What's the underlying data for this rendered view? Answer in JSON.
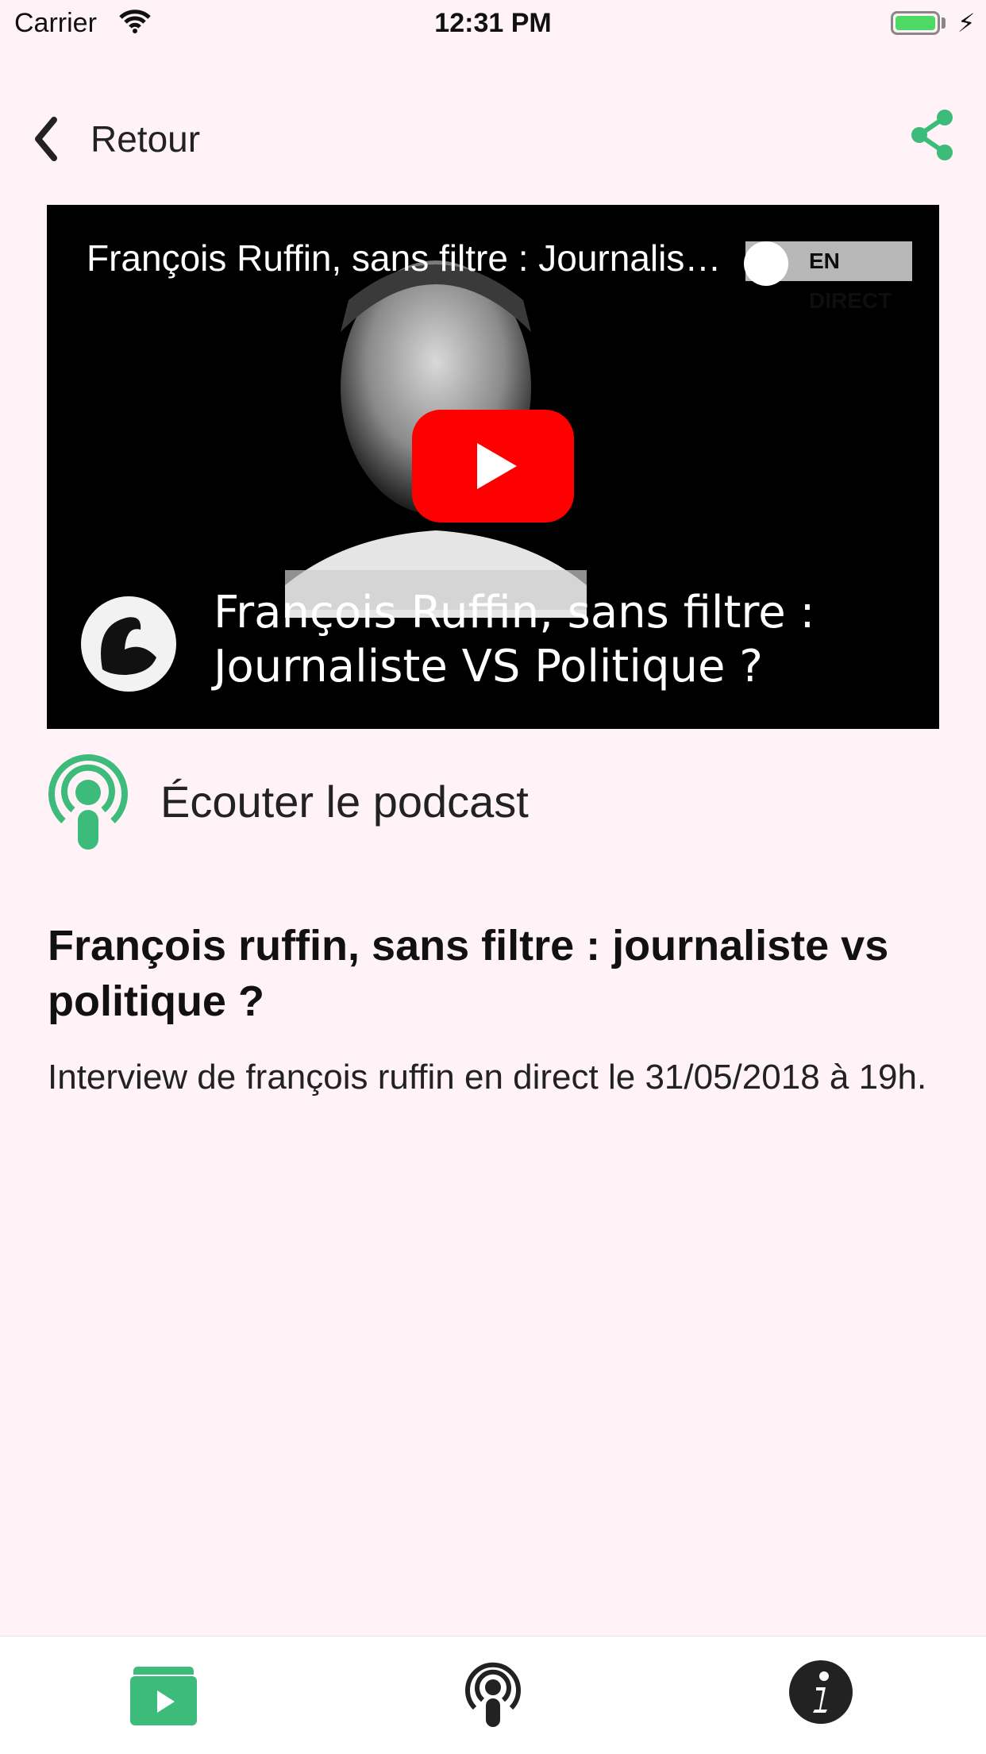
{
  "status_bar": {
    "carrier": "Carrier",
    "time": "12:31 PM",
    "charging_icon": "bolt-icon"
  },
  "nav": {
    "back_label": "Retour",
    "back_icon": "chevron-left-icon",
    "share_icon": "share-icon"
  },
  "video": {
    "title": "François Ruffin, sans filtre : Journaliste VS Politique ?",
    "live_badge": "EN DIRECT",
    "caption_line1": "François Ruffin, sans filtre :",
    "caption_line2": "Journaliste VS Politique ?",
    "play_icon": "youtube-play-icon"
  },
  "podcast": {
    "label": "Écouter le podcast",
    "icon": "podcast-icon"
  },
  "article": {
    "title": "François ruffin, sans filtre : journaliste vs politique ?",
    "description": "Interview de françois ruffin en direct le 31/05/2018 à 19h."
  },
  "tab_bar": {
    "items": [
      {
        "icon": "video-folder-icon",
        "active": true
      },
      {
        "icon": "podcast-icon",
        "active": false
      },
      {
        "icon": "info-icon",
        "active": false
      }
    ]
  },
  "colors": {
    "accent": "#3dbb7a",
    "background": "#fff3f7",
    "youtube_red": "#ff0000"
  }
}
